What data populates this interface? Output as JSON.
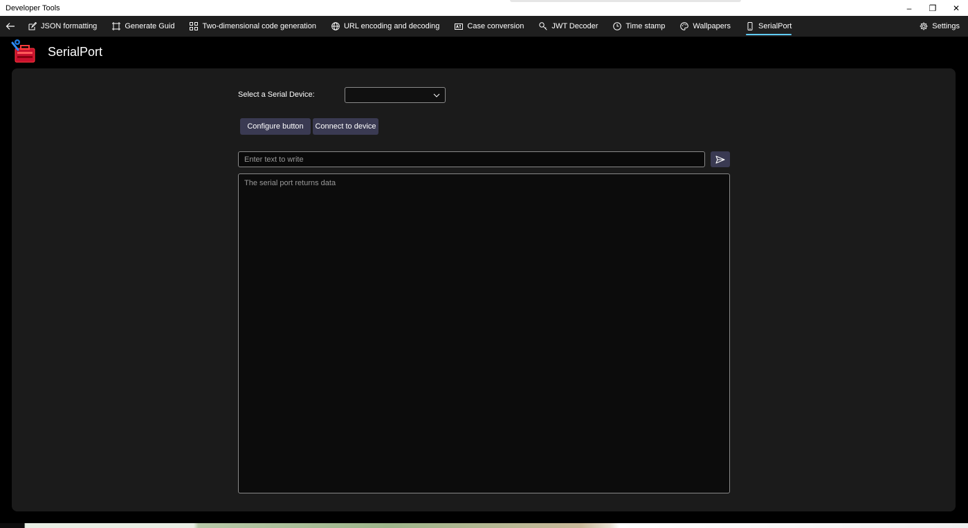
{
  "window": {
    "title": "Developer Tools",
    "controls": {
      "minimize": "–",
      "restore": "❐",
      "close": "✕"
    }
  },
  "nav": {
    "back_icon": "arrow-left-icon",
    "items": [
      {
        "label": "JSON formatting",
        "icon": "edit-icon"
      },
      {
        "label": "Generate Guid",
        "icon": "frame-icon"
      },
      {
        "label": "Two-dimensional code generation",
        "icon": "qr-grid-icon"
      },
      {
        "label": "URL encoding and decoding",
        "icon": "globe-icon"
      },
      {
        "label": "Case conversion",
        "icon": "font-size-icon"
      },
      {
        "label": "JWT Decoder",
        "icon": "key-icon"
      },
      {
        "label": "Time stamp",
        "icon": "clock-icon"
      },
      {
        "label": "Wallpapers",
        "icon": "palette-icon"
      },
      {
        "label": "SerialPort",
        "icon": "phone-icon"
      }
    ],
    "selected_index": 8,
    "settings_label": "Settings",
    "accent_color": "#60cdff"
  },
  "page": {
    "title": "SerialPort",
    "logo_icon": "toolbox-icon"
  },
  "form": {
    "device_label": "Select a Serial Device:",
    "device_selected": "",
    "configure_label": "Configure button",
    "connect_label": "Connect to device",
    "write_placeholder": "Enter text to write",
    "send_icon": "send-icon",
    "output_placeholder": "The serial port returns data"
  }
}
